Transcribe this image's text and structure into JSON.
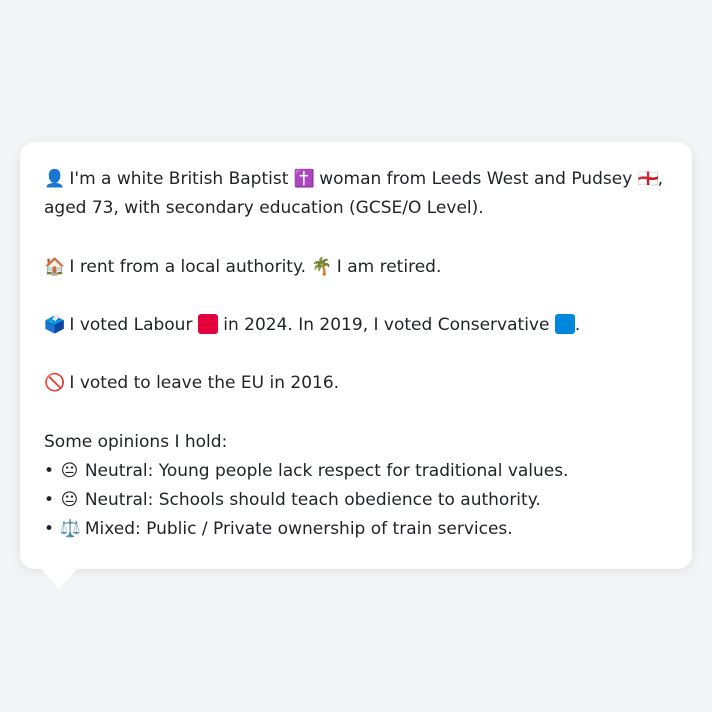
{
  "profile": {
    "line1": {
      "icon": "👤",
      "pre": " I'm a white British Baptist ",
      "religion_icon": "✝️",
      "post": " woman from Leeds West and Pudsey ",
      "flag_icon": "🏴󠁧󠁢󠁥󠁮󠁧󠁿",
      "end": ","
    },
    "line2": "aged 73, with secondary education (GCSE/O Level).",
    "housing": {
      "icon": "🏠",
      "text": " I rent from a local authority. ",
      "work_icon": "🌴",
      "work_text": " I am retired."
    },
    "vote": {
      "icon": "🗳️",
      "pre": " I voted Labour ",
      "labour_color": "#e4003b",
      "mid": " in 2024. In 2019, I voted Conservative ",
      "conservative_color": "#0087dc",
      "end": "."
    },
    "eu": {
      "icon": "🚫",
      "text": " I voted to leave the EU in 2016."
    },
    "opinions_heading": "Some opinions I hold:",
    "opinions": [
      {
        "bullet": "•",
        "icon": "😐",
        "text": " Neutral: Young people lack respect for traditional values."
      },
      {
        "bullet": "•",
        "icon": "😐",
        "text": " Neutral: Schools should teach obedience to authority."
      },
      {
        "bullet": "•",
        "icon": "⚖️",
        "text": " Mixed: Public / Private ownership of train services."
      }
    ]
  }
}
